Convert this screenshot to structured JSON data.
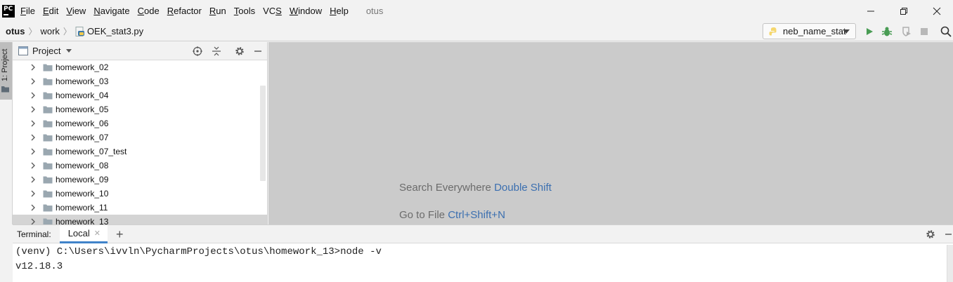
{
  "menubar": {
    "app_logo": "PC",
    "items": [
      "File",
      "Edit",
      "View",
      "Navigate",
      "Code",
      "Refactor",
      "Run",
      "Tools",
      "VCS",
      "Window",
      "Help"
    ],
    "project_title": "otus"
  },
  "navbar": {
    "breadcrumb": [
      "otus",
      "work",
      "OEK_stat3.py"
    ],
    "run_config": "neb_name_stat"
  },
  "left_stripe": {
    "project_tab": "1: Project"
  },
  "project_panel": {
    "title": "Project",
    "tree": [
      {
        "name": "homework_02",
        "selected": false
      },
      {
        "name": "homework_03",
        "selected": false
      },
      {
        "name": "homework_04",
        "selected": false
      },
      {
        "name": "homework_05",
        "selected": false
      },
      {
        "name": "homework_06",
        "selected": false
      },
      {
        "name": "homework_07",
        "selected": false
      },
      {
        "name": "homework_07_test",
        "selected": false
      },
      {
        "name": "homework_08",
        "selected": false
      },
      {
        "name": "homework_09",
        "selected": false
      },
      {
        "name": "homework_10",
        "selected": false
      },
      {
        "name": "homework_11",
        "selected": false
      },
      {
        "name": "homework_13",
        "selected": true
      }
    ]
  },
  "editor": {
    "hints": [
      {
        "text": "Search Everywhere",
        "key": "Double Shift"
      },
      {
        "text": "Go to File",
        "key": "Ctrl+Shift+N"
      }
    ]
  },
  "terminal": {
    "title": "Terminal:",
    "tab_label": "Local",
    "lines": [
      "(venv) C:\\Users\\ivvln\\PycharmProjects\\otus\\homework_13>node -v",
      "v12.18.3"
    ]
  },
  "colors": {
    "accent_blue": "#3b6fb0",
    "run_green": "#499c54",
    "editor_bg": "#cbcbcb",
    "selection": "#d4d4d4"
  }
}
